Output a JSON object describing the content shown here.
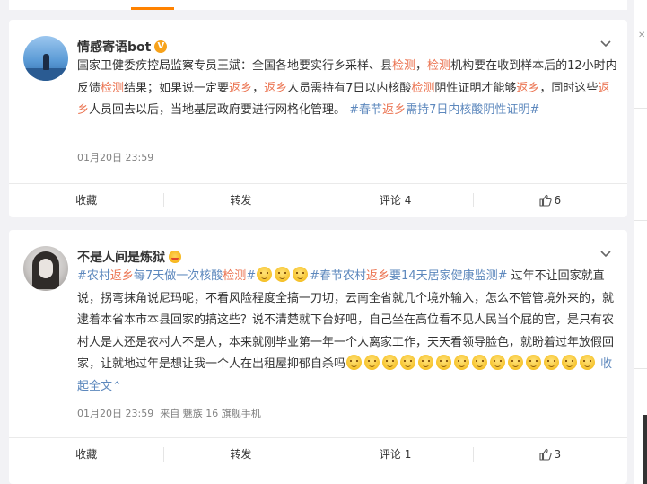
{
  "posts": [
    {
      "username": "情感寄语bot",
      "badge": "V",
      "segments": [
        {
          "t": "国家卫健委疾控局监察专员王斌：全国各地要实行乡采样、县",
          "c": "n"
        },
        {
          "t": "检测",
          "c": "hl"
        },
        {
          "t": "，",
          "c": "n"
        },
        {
          "t": "检测",
          "c": "hl"
        },
        {
          "t": "机构要在收到样本后的12小时内反馈",
          "c": "n"
        },
        {
          "t": "检测",
          "c": "hl"
        },
        {
          "t": "结果；如果说一定要",
          "c": "n"
        },
        {
          "t": "返乡",
          "c": "hl"
        },
        {
          "t": "，",
          "c": "n"
        },
        {
          "t": "返乡",
          "c": "hl"
        },
        {
          "t": "人员需持有7日以内核酸",
          "c": "n"
        },
        {
          "t": "检测",
          "c": "hl"
        },
        {
          "t": "阴性证明才能够",
          "c": "n"
        },
        {
          "t": "返乡",
          "c": "hl"
        },
        {
          "t": "，同时这些",
          "c": "n"
        },
        {
          "t": "返乡",
          "c": "hl"
        },
        {
          "t": "人员回去以后，当地基层政府要进行网格化管理。 ",
          "c": "n"
        },
        {
          "t": "#春节",
          "c": "tag"
        },
        {
          "t": "返乡",
          "c": "hl"
        },
        {
          "t": "需持7日内核酸阴性证明#",
          "c": "tag"
        }
      ],
      "time": "01月20日 23:59",
      "source": "",
      "actions": {
        "favorite": "收藏",
        "repost": "转发",
        "comment": "评论 4",
        "like": "6"
      }
    },
    {
      "username": "不是人间是炼狱",
      "segments": [
        {
          "t": "#农村",
          "c": "tag"
        },
        {
          "t": "返乡",
          "c": "hl"
        },
        {
          "t": "每7天做一次核酸",
          "c": "tag"
        },
        {
          "t": "检测",
          "c": "hl"
        },
        {
          "t": "#",
          "c": "tag"
        },
        {
          "t": "",
          "c": "emo"
        },
        {
          "t": "",
          "c": "emo"
        },
        {
          "t": "",
          "c": "emo"
        },
        {
          "t": "#春节农村",
          "c": "tag"
        },
        {
          "t": "返乡",
          "c": "hl"
        },
        {
          "t": "要14天居家健康监测#",
          "c": "tag"
        },
        {
          "t": " 过年不让回家就直说，拐弯抹角说尼玛呢，不看风险程度全搞一刀切，云南全省就几个境外输入，怎么不管管境外来的，就逮着本省本市本县回家的搞这些？说不清楚就下台好吧，自己坐在高位看不见人民当个屁的官，是只有农村人是人还是农村人不是人，本来就刚毕业第一年一个人离家工作，天天看领导脸色，就盼着过年放假回家，让就地过年是想让我一个人在出租屋抑郁自杀吗",
          "c": "n"
        },
        {
          "t": "",
          "c": "emo"
        },
        {
          "t": "",
          "c": "emo"
        },
        {
          "t": "",
          "c": "emo"
        },
        {
          "t": "",
          "c": "emo"
        },
        {
          "t": "",
          "c": "emo"
        },
        {
          "t": "",
          "c": "emo"
        },
        {
          "t": "",
          "c": "emo"
        },
        {
          "t": "",
          "c": "emo"
        },
        {
          "t": "",
          "c": "emo"
        },
        {
          "t": "",
          "c": "emo"
        },
        {
          "t": "",
          "c": "emo"
        },
        {
          "t": "",
          "c": "emo"
        },
        {
          "t": "",
          "c": "emo"
        },
        {
          "t": "",
          "c": "emo"
        },
        {
          "t": " 收起全文",
          "c": "tag"
        },
        {
          "t": "⌃",
          "c": "tag"
        }
      ],
      "time": "01月20日 23:59",
      "source": "来自 魅族 16 旗舰手机",
      "actions": {
        "favorite": "收藏",
        "repost": "转发",
        "comment": "评论 1",
        "like": "3"
      }
    }
  ],
  "colors": {
    "highlight": "#eb7350",
    "link": "#5d88bd",
    "accent": "#ff8200"
  },
  "icons": {
    "menu": "chevron-down-icon",
    "like": "thumbs-up-icon"
  }
}
